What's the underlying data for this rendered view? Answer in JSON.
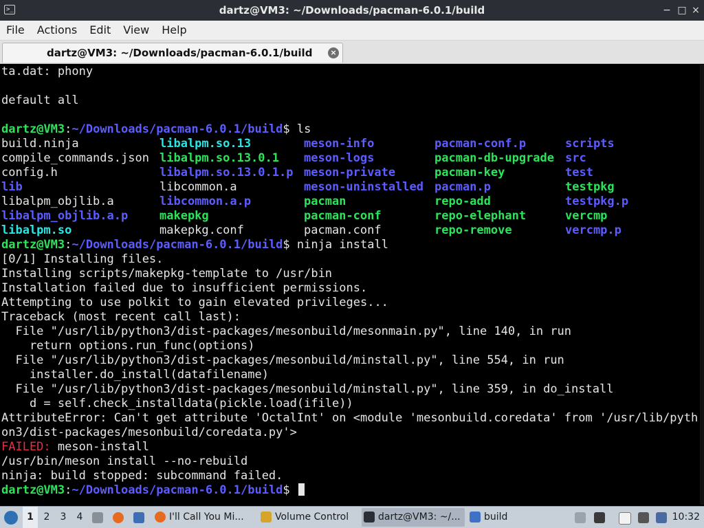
{
  "window": {
    "title": "dartz@VM3: ~/Downloads/pacman-6.0.1/build",
    "terminal_icon": "terminal-icon",
    "controls": {
      "minimize": "−",
      "maximize": "□",
      "close": "×"
    }
  },
  "menu": [
    "File",
    "Actions",
    "Edit",
    "View",
    "Help"
  ],
  "tab": {
    "label": "dartz@VM3: ~/Downloads/pacman-6.0.1/build",
    "close": "×"
  },
  "terminal": {
    "pre_lines": [
      "ta.dat: phony",
      "",
      "default all",
      ""
    ],
    "prompt": {
      "user": "dartz@VM3",
      "sep": ":",
      "path": "~/Downloads/pacman-6.0.1/build",
      "symbol": "$ "
    },
    "cmd_ls": "ls",
    "ls_columns": [
      [
        {
          "t": "build.ninja",
          "c": "plain"
        },
        {
          "t": "compile_commands.json",
          "c": "plain"
        },
        {
          "t": "config.h",
          "c": "plain"
        },
        {
          "t": "lib",
          "c": "blue"
        },
        {
          "t": "libalpm_objlib.a",
          "c": "plain"
        },
        {
          "t": "libalpm_objlib.a.p",
          "c": "blue"
        },
        {
          "t": "libalpm.so",
          "c": "cyan"
        }
      ],
      [
        {
          "t": "libalpm.so.13",
          "c": "cyan"
        },
        {
          "t": "libalpm.so.13.0.1",
          "c": "green"
        },
        {
          "t": "libalpm.so.13.0.1.p",
          "c": "blue"
        },
        {
          "t": "libcommon.a",
          "c": "plain"
        },
        {
          "t": "libcommon.a.p",
          "c": "blue"
        },
        {
          "t": "makepkg",
          "c": "green"
        },
        {
          "t": "makepkg.conf",
          "c": "plain"
        }
      ],
      [
        {
          "t": "meson-info",
          "c": "blue"
        },
        {
          "t": "meson-logs",
          "c": "blue"
        },
        {
          "t": "meson-private",
          "c": "blue"
        },
        {
          "t": "meson-uninstalled",
          "c": "blue"
        },
        {
          "t": "pacman",
          "c": "green"
        },
        {
          "t": "pacman-conf",
          "c": "green"
        },
        {
          "t": "pacman.conf",
          "c": "plain"
        }
      ],
      [
        {
          "t": "pacman-conf.p",
          "c": "blue"
        },
        {
          "t": "pacman-db-upgrade",
          "c": "green"
        },
        {
          "t": "pacman-key",
          "c": "green"
        },
        {
          "t": "pacman.p",
          "c": "blue"
        },
        {
          "t": "repo-add",
          "c": "green"
        },
        {
          "t": "repo-elephant",
          "c": "green"
        },
        {
          "t": "repo-remove",
          "c": "green"
        }
      ],
      [
        {
          "t": "scripts",
          "c": "blue"
        },
        {
          "t": "src",
          "c": "blue"
        },
        {
          "t": "test",
          "c": "blue"
        },
        {
          "t": "testpkg",
          "c": "green"
        },
        {
          "t": "testpkg.p",
          "c": "blue"
        },
        {
          "t": "vercmp",
          "c": "green"
        },
        {
          "t": "vercmp.p",
          "c": "blue"
        }
      ]
    ],
    "cmd_install": "ninja install",
    "output_lines": [
      "[0/1] Installing files.",
      "Installing scripts/makepkg-template to /usr/bin",
      "Installation failed due to insufficient permissions.",
      "Attempting to use polkit to gain elevated privileges...",
      "Traceback (most recent call last):",
      "  File \"/usr/lib/python3/dist-packages/mesonbuild/mesonmain.py\", line 140, in run",
      "    return options.run_func(options)",
      "  File \"/usr/lib/python3/dist-packages/mesonbuild/minstall.py\", line 554, in run",
      "    installer.do_install(datafilename)",
      "  File \"/usr/lib/python3/dist-packages/mesonbuild/minstall.py\", line 359, in do_install",
      "    d = self.check_installdata(pickle.load(ifile))",
      "AttributeError: Can't get attribute 'OctalInt' on <module 'mesonbuild.coredata' from '/usr/lib/pyth",
      "on3/dist-packages/mesonbuild/coredata.py'>"
    ],
    "failed_label": "FAILED:",
    "failed_text": " meson-install",
    "post_lines": [
      "/usr/bin/meson install --no-rebuild",
      "ninja: build stopped: subcommand failed."
    ]
  },
  "taskbar": {
    "workspaces": [
      "1",
      "2",
      "3",
      "4"
    ],
    "active_workspace": "1",
    "tasks": [
      {
        "label": "I'll Call You Mi...",
        "icon": "firefox-icon"
      },
      {
        "label": "Volume Control",
        "icon": "volume-control-icon"
      },
      {
        "label": "dartz@VM3: ~/...",
        "icon": "terminal-icon"
      },
      {
        "label": "build",
        "icon": "folder-icon"
      }
    ],
    "clock": "10:32"
  },
  "colors": {
    "prompt_user": "#2ce45a",
    "prompt_path": "#5c5cff",
    "dir": "#5c5cff",
    "exec": "#2ce45a",
    "symlink": "#29e6e6",
    "error": "#e0304a",
    "text": "#e6e6e6",
    "background": "#000000"
  }
}
